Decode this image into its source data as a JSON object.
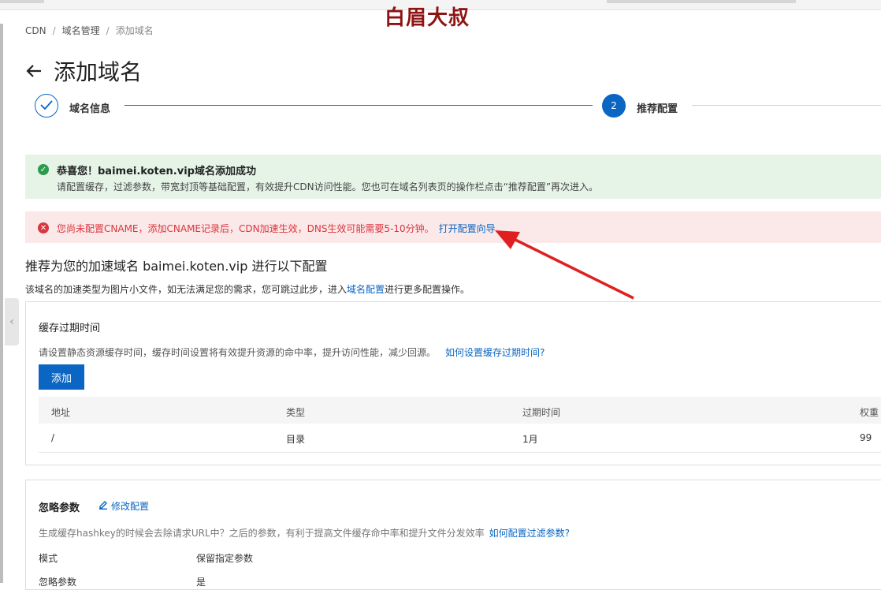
{
  "watermark": "白眉大叔",
  "breadcrumb": [
    "CDN",
    "域名管理",
    "添加域名"
  ],
  "page_title": "添加域名",
  "steps": [
    {
      "label": "域名信息",
      "state": "done"
    },
    {
      "number": "2",
      "label": "推荐配置",
      "state": "active"
    }
  ],
  "success_alert": {
    "title": "恭喜您！baimei.koten.vip域名添加成功",
    "desc": "请配置缓存，过滤参数，带宽封顶等基础配置，有效提升CDN访问性能。您也可在域名列表页的操作栏点击“推荐配置”再次进入。"
  },
  "error_alert": {
    "text": "您尚未配置CNAME，添加CNAME记录后，CDN加速生效，DNS生效可能需要5-10分钟。",
    "link": "打开配置向导"
  },
  "recommend": {
    "title": "推荐为您的加速域名 baimei.koten.vip 进行以下配置",
    "desc_prefix": "该域名的加速类型为图片小文件，如无法满足您的需求，您可跳过此步，进入",
    "desc_link": "域名配置",
    "desc_suffix": "进行更多配置操作。"
  },
  "cache_card": {
    "title": "缓存过期时间",
    "desc": "请设置静态资源缓存时间，缓存时间设置将有效提升资源的命中率，提升访问性能，减少回源。",
    "help_link": "如何设置缓存过期时间?",
    "add_button": "添加",
    "columns": [
      "地址",
      "类型",
      "过期时间",
      "权重"
    ],
    "rows": [
      {
        "path": "/",
        "type": "目录",
        "expire": "1月",
        "weight": "99"
      }
    ]
  },
  "ignore_card": {
    "title": "忽略参数",
    "edit_link": "修改配置",
    "desc": "生成缓存hashkey的时候会去除请求URL中？之后的参数，有利于提高文件缓存命中率和提升文件分发效率",
    "help_link": "如何配置过滤参数?",
    "fields": [
      {
        "key": "模式",
        "value": "保留指定参数"
      },
      {
        "key": "忽略参数",
        "value": "是"
      }
    ]
  },
  "colors": {
    "primary": "#0a66c2",
    "success_bg": "#e6f4e8",
    "error_bg": "#fbe8e8",
    "error_text": "#d9363e",
    "arrow": "#e02020"
  }
}
